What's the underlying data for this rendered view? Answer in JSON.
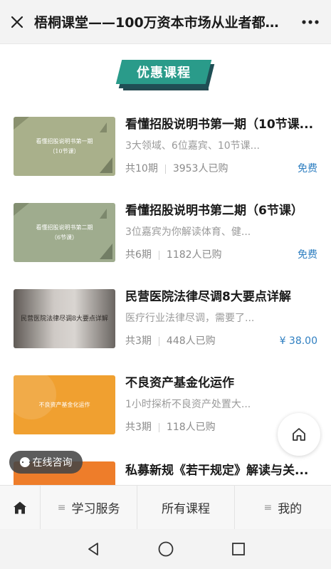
{
  "titlebar": {
    "title": "梧桐课堂——100万资本市场从业者都在...",
    "close_icon": "close-icon",
    "more_icon": "more-icon"
  },
  "section": {
    "heading": "优惠课程",
    "accent_color": "#2a9b8a"
  },
  "courses": [
    {
      "thumb_text_line1": "看懂招股说明书第一期",
      "thumb_text_line2": "（10节课）",
      "title": "看懂招股说明书第一期（10节课...",
      "desc": "3大领域、6位嘉宾、10节课...",
      "episodes": "共10期",
      "buyers": "3953人已购",
      "price": "免费"
    },
    {
      "thumb_text_line1": "看懂招股说明书第二期",
      "thumb_text_line2": "（6节课）",
      "title": "看懂招股说明书第二期（6节课）",
      "desc": "3位嘉宾为你解读体育、健...",
      "episodes": "共6期",
      "buyers": "1182人已购",
      "price": "免费"
    },
    {
      "thumb_text_line1": "民营医院法律尽调8大要点详解",
      "thumb_text_line2": "",
      "title": "民营医院法律尽调8大要点详解",
      "desc": "医疗行业法律尽调，需要了...",
      "episodes": "共3期",
      "buyers": "448人已购",
      "price": "¥ 38.00"
    },
    {
      "thumb_text_line1": "不良资产基金化运作",
      "thumb_text_line2": "",
      "title": "不良资产基金化运作",
      "desc": "1小时探析不良资产处置大...",
      "episodes": "共3期",
      "buyers": "118人已购",
      "price": ""
    },
    {
      "thumb_text_line1": "",
      "thumb_text_line2": "",
      "title": "私募新规《若干规定》解读与关...",
      "desc": "",
      "episodes": "",
      "buyers": "",
      "price": ""
    }
  ],
  "consult": {
    "label": "在线咨询"
  },
  "bottom_nav": {
    "home_icon": "home-icon",
    "study": "学习服务",
    "all_courses": "所有课程",
    "mine": "我的"
  },
  "price_color": "#2f7fc1"
}
